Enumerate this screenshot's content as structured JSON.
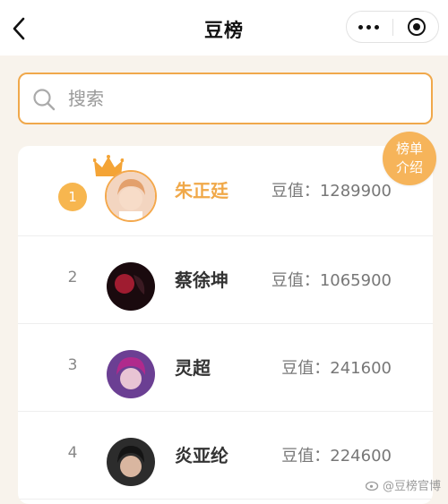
{
  "header": {
    "title": "豆榜"
  },
  "search": {
    "placeholder": "搜索"
  },
  "intro_button": {
    "line1": "榜单",
    "line2": "介绍"
  },
  "ranking": [
    {
      "rank": "1",
      "name": "朱正廷",
      "score": "豆值：1289900"
    },
    {
      "rank": "2",
      "name": "蔡徐坤",
      "score": "豆值：1065900"
    },
    {
      "rank": "3",
      "name": "灵超",
      "score": "豆值：241600"
    },
    {
      "rank": "4",
      "name": "炎亚纶",
      "score": "豆值：224600"
    }
  ],
  "watermark": {
    "text": "@豆榜官博"
  },
  "colors": {
    "accent": "#f0a84b",
    "gold": "#f7b64f",
    "background": "#f8f3ec"
  }
}
